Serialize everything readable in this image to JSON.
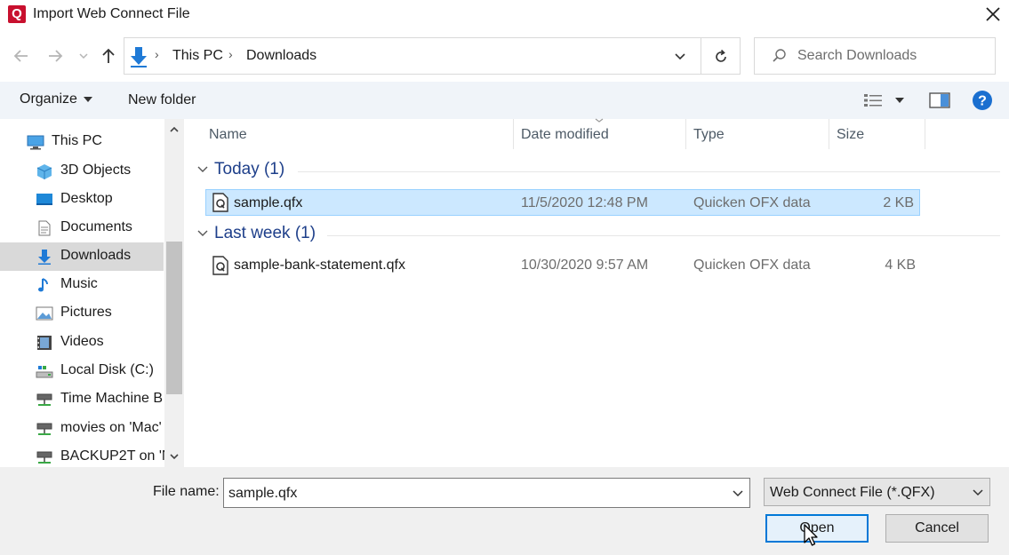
{
  "window": {
    "title": "Import Web Connect File",
    "app_icon": "Q"
  },
  "address": {
    "crumbs": [
      "This PC",
      "Downloads"
    ]
  },
  "search": {
    "placeholder": "Search Downloads"
  },
  "toolbar": {
    "organize": "Organize",
    "new_folder": "New folder"
  },
  "nav": {
    "items": [
      {
        "label": "This PC",
        "icon": "computer-icon"
      },
      {
        "label": "3D Objects",
        "icon": "cube-icon"
      },
      {
        "label": "Desktop",
        "icon": "desktop-icon"
      },
      {
        "label": "Documents",
        "icon": "document-icon"
      },
      {
        "label": "Downloads",
        "icon": "download-icon",
        "selected": true
      },
      {
        "label": "Music",
        "icon": "music-icon"
      },
      {
        "label": "Pictures",
        "icon": "pictures-icon"
      },
      {
        "label": "Videos",
        "icon": "film-icon"
      },
      {
        "label": "Local Disk (C:)",
        "icon": "drive-icon"
      },
      {
        "label": "Time Machine B",
        "icon": "network-drive-icon"
      },
      {
        "label": "movies on 'Mac'",
        "icon": "network-drive-icon"
      },
      {
        "label": "BACKUP2T on 'N",
        "icon": "network-drive-icon"
      }
    ]
  },
  "columns": {
    "name": "Name",
    "date": "Date modified",
    "type": "Type",
    "size": "Size"
  },
  "groups": [
    {
      "label": "Today (1)",
      "files": [
        {
          "name": "sample.qfx",
          "date": "11/5/2020 12:48 PM",
          "type": "Quicken OFX data",
          "size": "2 KB",
          "selected": true
        }
      ]
    },
    {
      "label": "Last week (1)",
      "files": [
        {
          "name": "sample-bank-statement.qfx",
          "date": "10/30/2020 9:57 AM",
          "type": "Quicken OFX data",
          "size": "4 KB"
        }
      ]
    }
  ],
  "footer": {
    "file_name_label": "File name:",
    "file_name_value": "sample.qfx",
    "file_type": "Web Connect File (*.QFX)",
    "open": "Open",
    "cancel": "Cancel"
  },
  "colors": {
    "accent": "#0078d7",
    "selection": "#cce8ff",
    "group_text": "#1e3f8a",
    "app_red": "#c8102e"
  }
}
